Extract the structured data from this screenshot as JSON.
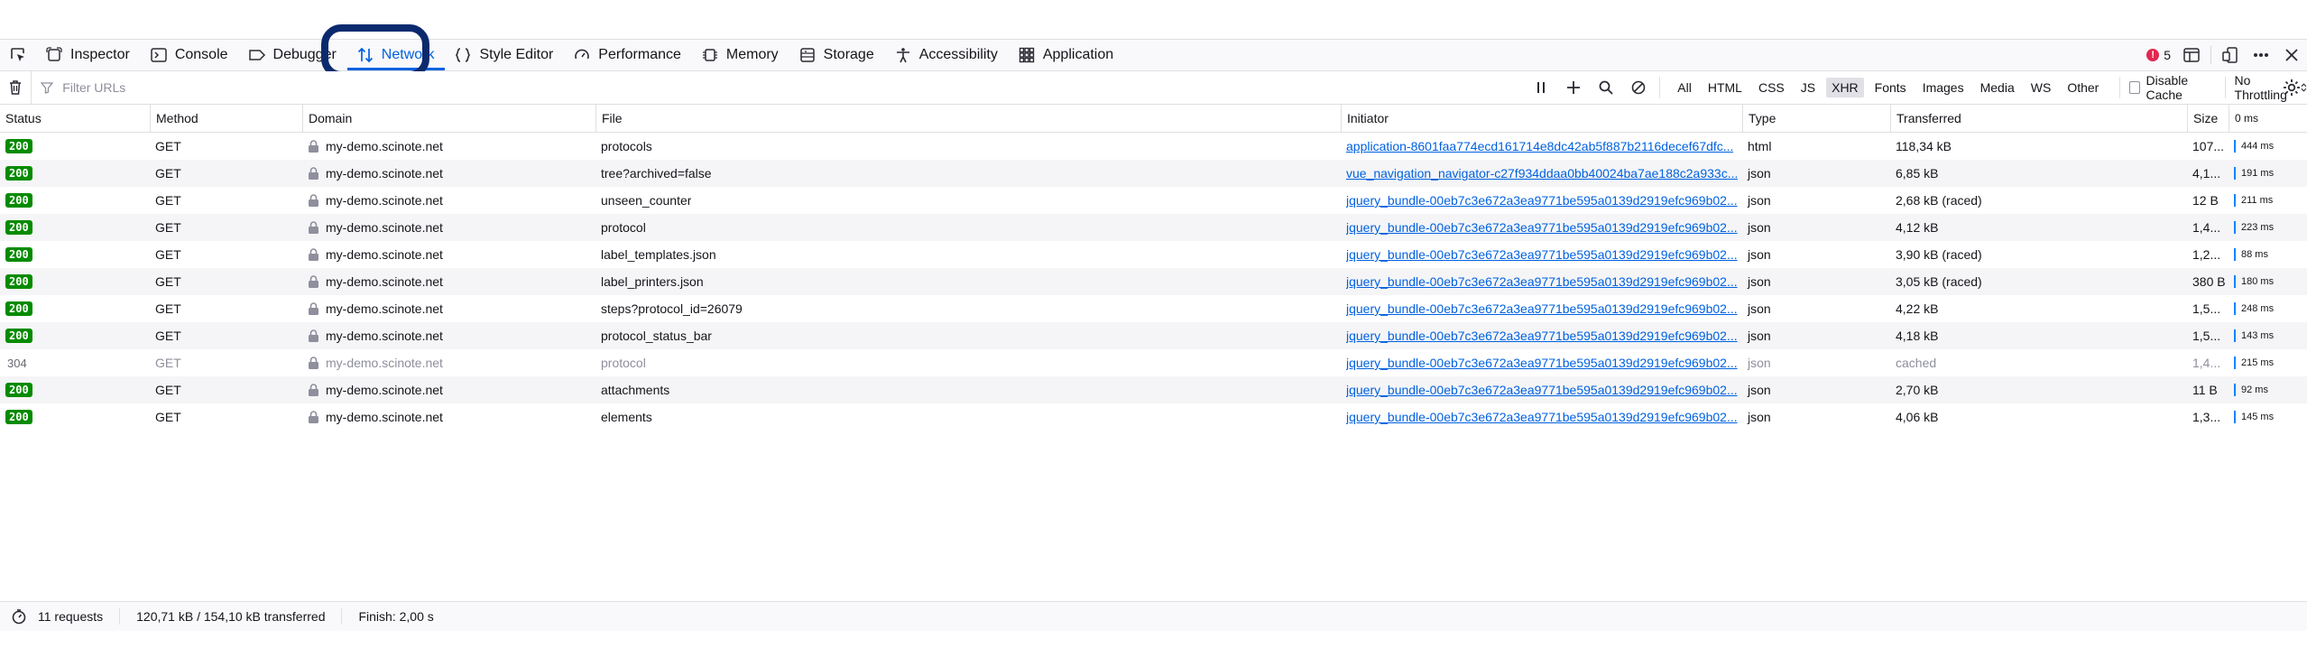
{
  "tabs": [
    {
      "label": "Inspector",
      "icon": "inspector-icon"
    },
    {
      "label": "Console",
      "icon": "console-icon"
    },
    {
      "label": "Debugger",
      "icon": "debugger-icon"
    },
    {
      "label": "Network",
      "icon": "network-icon",
      "selected": true
    },
    {
      "label": "Style Editor",
      "icon": "style-editor-icon"
    },
    {
      "label": "Performance",
      "icon": "performance-icon"
    },
    {
      "label": "Memory",
      "icon": "memory-icon"
    },
    {
      "label": "Storage",
      "icon": "storage-icon"
    },
    {
      "label": "Accessibility",
      "icon": "accessibility-icon"
    },
    {
      "label": "Application",
      "icon": "application-icon"
    }
  ],
  "toolbar_right": {
    "error_count": "5",
    "error_mark": "!"
  },
  "filter": {
    "placeholder": "Filter URLs",
    "value": ""
  },
  "request_types": [
    "All",
    "HTML",
    "CSS",
    "JS",
    "XHR",
    "Fonts",
    "Images",
    "Media",
    "WS",
    "Other"
  ],
  "active_type": "XHR",
  "disable_cache_label": "Disable Cache",
  "throttling_label": "No Throttling",
  "columns": {
    "status": "Status",
    "method": "Method",
    "domain": "Domain",
    "file": "File",
    "initiator": "Initiator",
    "type": "Type",
    "transferred": "Transferred",
    "size": "Size",
    "waterfall": "0 ms"
  },
  "requests": [
    {
      "status": "200",
      "method": "GET",
      "domain": "my-demo.scinote.net",
      "file": "protocols",
      "initiator": "application-8601faa774ecd161714e8dc42ab5f887b2116decef67dfc...",
      "type": "html",
      "transferred": "118,34 kB",
      "size": "107...",
      "time": "444 ms"
    },
    {
      "status": "200",
      "method": "GET",
      "domain": "my-demo.scinote.net",
      "file": "tree?archived=false",
      "initiator": "vue_navigation_navigator-c27f934ddaa0bb40024ba7ae188c2a933c...",
      "type": "json",
      "transferred": "6,85 kB",
      "size": "4,1...",
      "time": "191 ms"
    },
    {
      "status": "200",
      "method": "GET",
      "domain": "my-demo.scinote.net",
      "file": "unseen_counter",
      "initiator": "jquery_bundle-00eb7c3e672a3ea9771be595a0139d2919efc969b02...",
      "type": "json",
      "transferred": "2,68 kB (raced)",
      "size": "12 B",
      "time": "211 ms"
    },
    {
      "status": "200",
      "method": "GET",
      "domain": "my-demo.scinote.net",
      "file": "protocol",
      "initiator": "jquery_bundle-00eb7c3e672a3ea9771be595a0139d2919efc969b02...",
      "type": "json",
      "transferred": "4,12 kB",
      "size": "1,4...",
      "time": "223 ms"
    },
    {
      "status": "200",
      "method": "GET",
      "domain": "my-demo.scinote.net",
      "file": "label_templates.json",
      "initiator": "jquery_bundle-00eb7c3e672a3ea9771be595a0139d2919efc969b02...",
      "type": "json",
      "transferred": "3,90 kB (raced)",
      "size": "1,2...",
      "time": "88 ms"
    },
    {
      "status": "200",
      "method": "GET",
      "domain": "my-demo.scinote.net",
      "file": "label_printers.json",
      "initiator": "jquery_bundle-00eb7c3e672a3ea9771be595a0139d2919efc969b02...",
      "type": "json",
      "transferred": "3,05 kB (raced)",
      "size": "380 B",
      "time": "180 ms"
    },
    {
      "status": "200",
      "method": "GET",
      "domain": "my-demo.scinote.net",
      "file": "steps?protocol_id=26079",
      "initiator": "jquery_bundle-00eb7c3e672a3ea9771be595a0139d2919efc969b02...",
      "type": "json",
      "transferred": "4,22 kB",
      "size": "1,5...",
      "time": "248 ms"
    },
    {
      "status": "200",
      "method": "GET",
      "domain": "my-demo.scinote.net",
      "file": "protocol_status_bar",
      "initiator": "jquery_bundle-00eb7c3e672a3ea9771be595a0139d2919efc969b02...",
      "type": "json",
      "transferred": "4,18 kB",
      "size": "1,5...",
      "time": "143 ms"
    },
    {
      "status": "304",
      "method": "GET",
      "domain": "my-demo.scinote.net",
      "file": "protocol",
      "initiator": "jquery_bundle-00eb7c3e672a3ea9771be595a0139d2919efc969b02...",
      "type": "json",
      "transferred": "cached",
      "size": "1,4...",
      "time": "215 ms",
      "cached": true
    },
    {
      "status": "200",
      "method": "GET",
      "domain": "my-demo.scinote.net",
      "file": "attachments",
      "initiator": "jquery_bundle-00eb7c3e672a3ea9771be595a0139d2919efc969b02...",
      "type": "json",
      "transferred": "2,70 kB",
      "size": "11 B",
      "time": "92 ms"
    },
    {
      "status": "200",
      "method": "GET",
      "domain": "my-demo.scinote.net",
      "file": "elements",
      "initiator": "jquery_bundle-00eb7c3e672a3ea9771be595a0139d2919efc969b02...",
      "type": "json",
      "transferred": "4,06 kB",
      "size": "1,3...",
      "time": "145 ms"
    }
  ],
  "footer": {
    "requests": "11 requests",
    "transferred": "120,71 kB / 154,10 kB transferred",
    "finish": "Finish: 2,00 s"
  },
  "colors": {
    "accent": "#0061e0",
    "status_ok": "#058b00",
    "highlight_ring": "#0b2a6e",
    "error": "#e22850"
  }
}
